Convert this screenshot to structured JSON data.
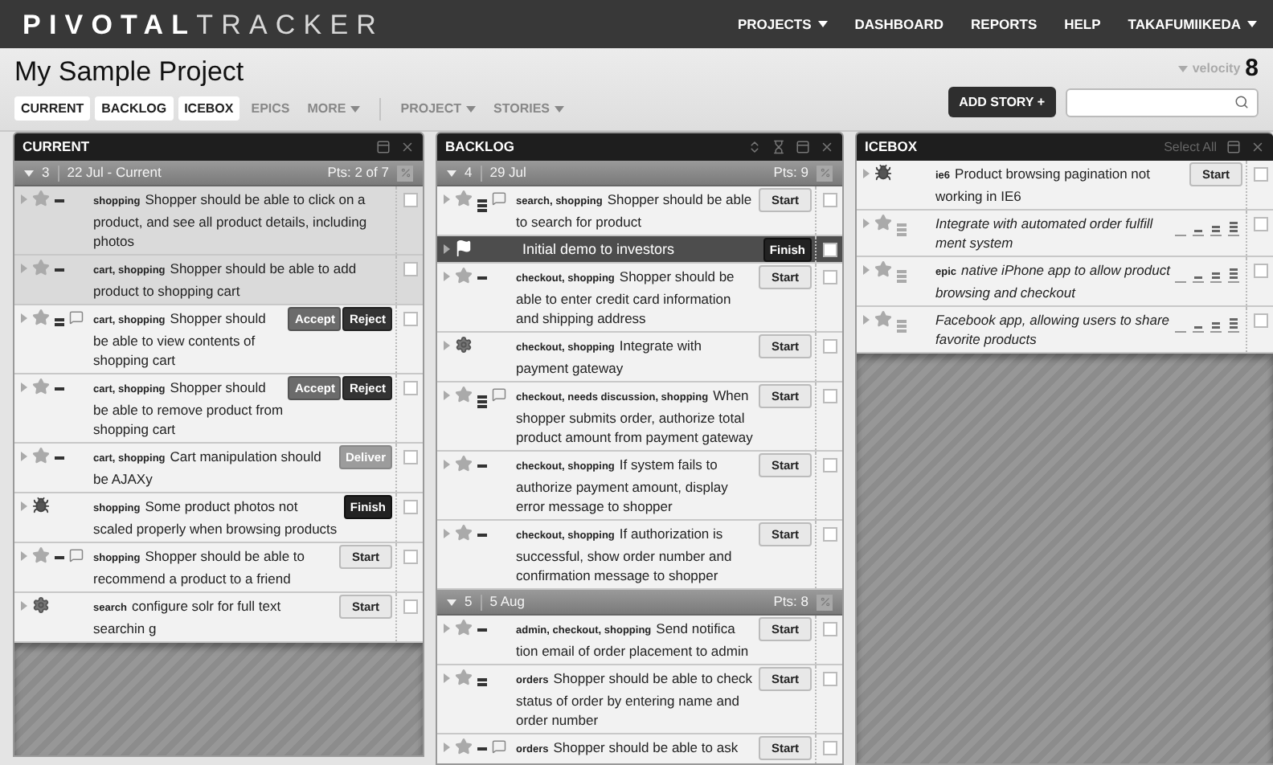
{
  "top_bar": {
    "logo_bold": "PIVOTAL",
    "logo_light": "TRACKER",
    "nav": [
      {
        "label": "PROJECTS",
        "has_menu": true
      },
      {
        "label": "DASHBOARD",
        "has_menu": false
      },
      {
        "label": "REPORTS",
        "has_menu": false
      },
      {
        "label": "HELP",
        "has_menu": false
      },
      {
        "label": "TAKAFUMIIKEDA",
        "has_menu": true
      }
    ]
  },
  "project_bar": {
    "title": "My Sample Project",
    "tabs": [
      {
        "label": "CURRENT",
        "selected": true,
        "has_menu": false
      },
      {
        "label": "BACKLOG",
        "selected": true,
        "has_menu": false
      },
      {
        "label": "ICEBOX",
        "selected": true,
        "has_menu": false
      },
      {
        "label": "EPICS",
        "selected": false,
        "has_menu": false
      },
      {
        "label": "MORE",
        "selected": false,
        "has_menu": true
      }
    ],
    "menus": [
      {
        "label": "PROJECT"
      },
      {
        "label": "STORIES"
      }
    ],
    "velocity_label": "velocity",
    "velocity": "8",
    "add_story": "ADD STORY +"
  },
  "panels": [
    {
      "title": "CURRENT",
      "actions": [
        {
          "kind": "panel"
        },
        {
          "kind": "close"
        }
      ],
      "items": [
        {
          "kind": "iteration",
          "number": "3",
          "date": "22 Jul - Current",
          "points": "Pts: 2 of 7"
        },
        {
          "kind": "feature",
          "estimate": {
            "kind": "single"
          },
          "comment": false,
          "accepted": true,
          "labels": "shopping",
          "title": "Shopper should be able to click on a product, and see all product details, including photos"
        },
        {
          "kind": "feature",
          "estimate": {
            "kind": "single"
          },
          "comment": false,
          "accepted": true,
          "labels": "cart, shopping",
          "title": "Shopper should be able to add product to shopping cart"
        },
        {
          "kind": "feature",
          "estimate": {
            "kind": "double"
          },
          "comment": true,
          "accepted": false,
          "labels": "cart, shopping",
          "title": "Shopper should be able to view contents of shopping cart",
          "buttons": [
            {
              "label": "Accept",
              "kind": "accept"
            },
            {
              "label": "Reject",
              "kind": "reject"
            }
          ]
        },
        {
          "kind": "feature",
          "estimate": {
            "kind": "single"
          },
          "comment": false,
          "accepted": false,
          "labels": "cart, shopping",
          "title": "Shopper should be able to remove product from shopping cart",
          "buttons": [
            {
              "label": "Accept",
              "kind": "accept"
            },
            {
              "label": "Reject",
              "kind": "reject"
            }
          ]
        },
        {
          "kind": "feature",
          "estimate": {
            "kind": "single"
          },
          "comment": false,
          "accepted": false,
          "labels": "cart, shopping",
          "title": "Cart manipulation should be AJAXy",
          "buttons": [
            {
              "label": "Deliver",
              "kind": "deliver"
            }
          ]
        },
        {
          "kind": "bug",
          "comment": false,
          "accepted": false,
          "labels": "shopping",
          "title": "Some product photos not scaled properly when browsing products",
          "buttons": [
            {
              "label": "Finish",
              "kind": "finish"
            }
          ]
        },
        {
          "kind": "feature",
          "estimate": {
            "kind": "single"
          },
          "comment": true,
          "accepted": false,
          "labels": "shopping",
          "title": "Shopper should be able to recommend a product to a friend",
          "buttons": [
            {
              "label": "Start",
              "kind": "start"
            }
          ]
        },
        {
          "kind": "chore",
          "comment": false,
          "accepted": false,
          "labels": "search",
          "title": "configure solr for full text searchin g",
          "buttons": [
            {
              "label": "Start",
              "kind": "start"
            }
          ]
        }
      ]
    },
    {
      "title": "BACKLOG",
      "actions": [
        {
          "kind": "updown"
        },
        {
          "kind": "hourglass"
        },
        {
          "kind": "panel"
        },
        {
          "kind": "close"
        }
      ],
      "items": [
        {
          "kind": "iteration",
          "number": "4",
          "date": "29 Jul",
          "points": "Pts: 9"
        },
        {
          "kind": "feature",
          "estimate": {
            "kind": "triple"
          },
          "comment": true,
          "accepted": false,
          "labels": "search, shopping",
          "title": "Shopper should be able to search for product",
          "buttons": [
            {
              "label": "Start",
              "kind": "start"
            }
          ]
        },
        {
          "kind": "release",
          "checked": false,
          "title": "Initial demo to investors",
          "buttons": [
            {
              "label": "Finish",
              "kind": "finish"
            }
          ]
        },
        {
          "kind": "feature",
          "estimate": {
            "kind": "single"
          },
          "comment": false,
          "accepted": false,
          "labels": "checkout, shopping",
          "title": "Shopper should be able to enter credit card information and shipping address",
          "buttons": [
            {
              "label": "Start",
              "kind": "start"
            }
          ]
        },
        {
          "kind": "chore",
          "comment": false,
          "accepted": false,
          "labels": "checkout, shopping",
          "title": "Integrate with payment gateway",
          "buttons": [
            {
              "label": "Start",
              "kind": "start"
            }
          ]
        },
        {
          "kind": "feature",
          "estimate": {
            "kind": "triple"
          },
          "comment": true,
          "accepted": false,
          "labels": "checkout, needs discussion, shopping",
          "title": "When shopper submits order, authorize total product amount from payment gateway",
          "buttons": [
            {
              "label": "Start",
              "kind": "start"
            }
          ]
        },
        {
          "kind": "feature",
          "estimate": {
            "kind": "single"
          },
          "comment": false,
          "accepted": false,
          "labels": "checkout, shopping",
          "title": "If system fails to authorize payment amount, display error message to shopper",
          "buttons": [
            {
              "label": "Start",
              "kind": "start"
            }
          ]
        },
        {
          "kind": "feature",
          "estimate": {
            "kind": "single"
          },
          "comment": false,
          "accepted": false,
          "labels": "checkout, shopping",
          "title": "If authorization is successful, show order number and confirmation message to shopper",
          "buttons": [
            {
              "label": "Start",
              "kind": "start"
            }
          ]
        },
        {
          "kind": "iteration",
          "number": "5",
          "date": "5 Aug",
          "points": "Pts: 8"
        },
        {
          "kind": "feature",
          "estimate": {
            "kind": "single"
          },
          "comment": false,
          "accepted": false,
          "labels": "admin, checkout, shopping",
          "title": "Send notifica tion email of order placement to admin",
          "buttons": [
            {
              "label": "Start",
              "kind": "start"
            }
          ]
        },
        {
          "kind": "feature",
          "estimate": {
            "kind": "double"
          },
          "comment": false,
          "accepted": false,
          "labels": "orders",
          "title": "Shopper should be able to check status of order by entering name and order number",
          "buttons": [
            {
              "label": "Start",
              "kind": "start"
            }
          ]
        },
        {
          "kind": "feature",
          "estimate": {
            "kind": "single"
          },
          "comment": true,
          "accepted": false,
          "labels": "orders",
          "title": "Shopper should be able to ask",
          "buttons": [
            {
              "label": "Start",
              "kind": "start"
            }
          ]
        }
      ]
    },
    {
      "title": "ICEBOX",
      "select_all": "Select All",
      "actions": [
        {
          "kind": "panel"
        },
        {
          "kind": "close"
        }
      ],
      "items": [
        {
          "kind": "bug",
          "comment": false,
          "accepted": false,
          "labels": "ie6",
          "title": "Product browsing pagination not working in IE6",
          "buttons": [
            {
              "label": "Start",
              "kind": "start"
            }
          ]
        },
        {
          "kind": "feature",
          "estimate": {
            "kind": "unestimated"
          },
          "comment": false,
          "accepted": false,
          "title": "Integrate with automated order fulfill ment system"
        },
        {
          "kind": "feature",
          "estimate": {
            "kind": "unestimated"
          },
          "comment": false,
          "accepted": false,
          "labels": "epic",
          "title": "native iPhone app to allow product browsing and checkout"
        },
        {
          "kind": "feature",
          "estimate": {
            "kind": "unestimated"
          },
          "comment": false,
          "accepted": false,
          "title": "Facebook app, allowing users to share favorite products"
        }
      ]
    }
  ]
}
